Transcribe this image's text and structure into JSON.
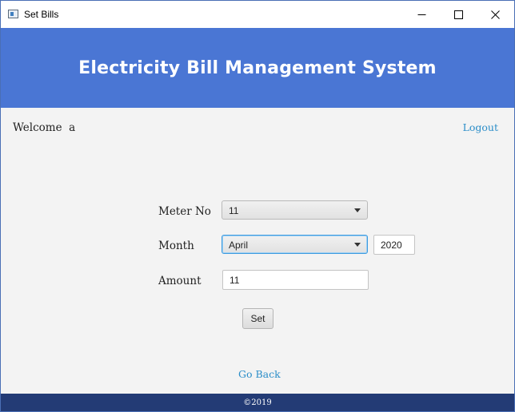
{
  "window": {
    "title": "Set Bills",
    "controls": {
      "minimize_icon": "minimize-icon",
      "maximize_icon": "maximize-icon",
      "close_icon": "close-icon"
    }
  },
  "header": {
    "title": "Electricity Bill Management System",
    "background_color": "#4a76d4"
  },
  "user_bar": {
    "welcome_text": "Welcome  a",
    "logout_label": "Logout"
  },
  "form": {
    "meter_label": "Meter No",
    "meter_value": "11",
    "month_label": "Month",
    "month_value": "April",
    "year_value": "2020",
    "amount_label": "Amount",
    "amount_value": "11",
    "set_label": "Set"
  },
  "navigation": {
    "go_back_label": "Go Back"
  },
  "footer": {
    "text": "©2019",
    "background_color": "#233b75"
  },
  "colors": {
    "link": "#2a8dc8",
    "focus_border": "#3d9be0"
  }
}
